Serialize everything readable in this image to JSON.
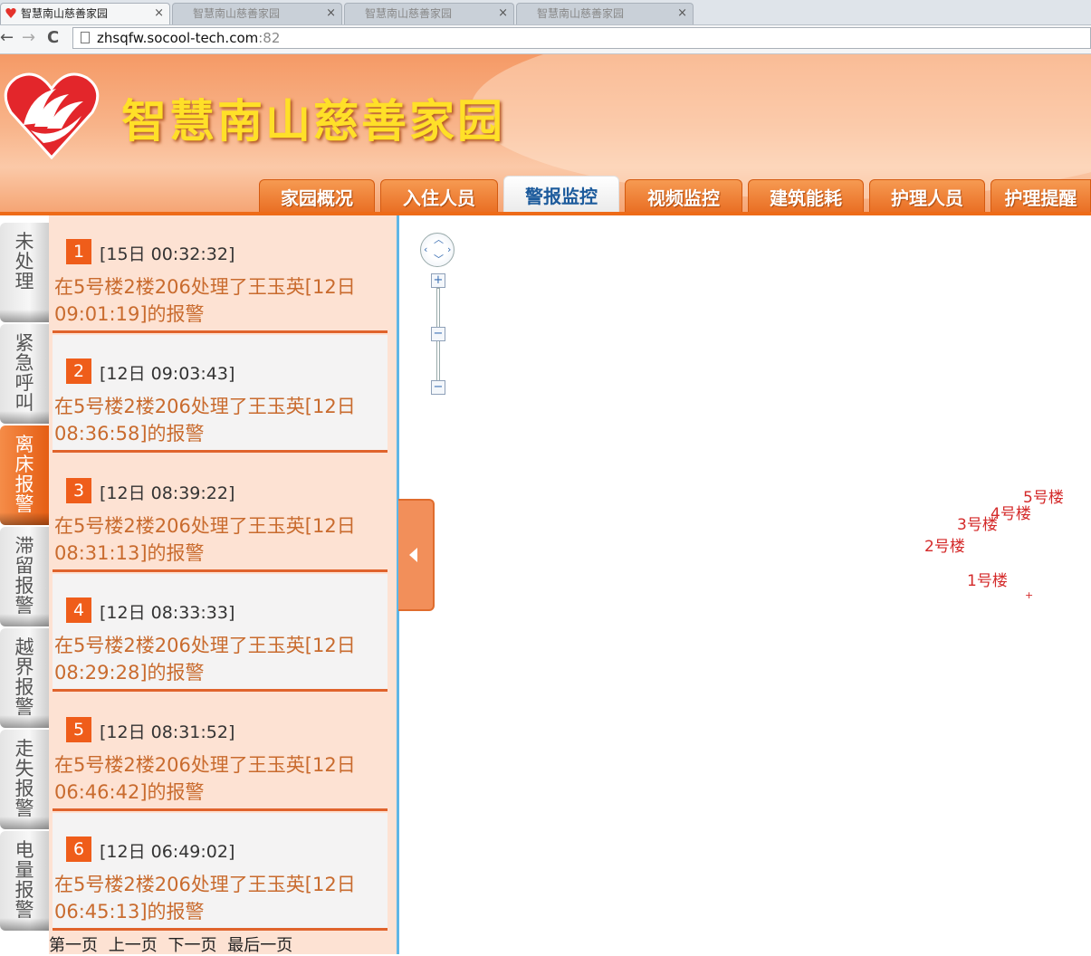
{
  "browser": {
    "tabs": [
      {
        "title": "智慧南山慈善家园",
        "close": "×"
      },
      {
        "title": "智慧南山慈善家园",
        "close": "×"
      },
      {
        "title": "智慧南山慈善家园",
        "close": "×"
      },
      {
        "title": "智慧南山慈善家园",
        "close": "×"
      }
    ],
    "url_host": "zhsqfw.socool-tech.com",
    "url_port": ":82",
    "back": "←",
    "forward": "→",
    "reload": "C"
  },
  "site": {
    "title": "智慧南山慈善家园",
    "nav": [
      "家园概况",
      "入住人员",
      "警报监控",
      "视频监控",
      "建筑能耗",
      "护理人员",
      "护理提醒"
    ],
    "active_nav": "警报监控"
  },
  "categories": [
    "未处理",
    "紧急呼叫",
    "离床报警",
    "滞留报警",
    "越界报警",
    "走失报警",
    "电量报警"
  ],
  "active_category": "离床报警",
  "alarms": [
    {
      "num": "1",
      "time": "[15日 00:32:32]",
      "desc": "在5号楼2楼206处理了王玉英[12日09:01:19]的报警"
    },
    {
      "num": "2",
      "time": "[12日 09:03:43]",
      "desc": "在5号楼2楼206处理了王玉英[12日08:36:58]的报警"
    },
    {
      "num": "3",
      "time": "[12日 08:39:22]",
      "desc": "在5号楼2楼206处理了王玉英[12日08:31:13]的报警"
    },
    {
      "num": "4",
      "time": "[12日 08:33:33]",
      "desc": "在5号楼2楼206处理了王玉英[12日08:29:28]的报警"
    },
    {
      "num": "5",
      "time": "[12日 08:31:52]",
      "desc": "在5号楼2楼206处理了王玉英[12日06:46:42]的报警"
    },
    {
      "num": "6",
      "time": "[12日 06:49:02]",
      "desc": "在5号楼2楼206处理了王玉英[12日06:45:13]的报警"
    }
  ],
  "pager": {
    "first": "第一页",
    "prev": "上一页",
    "next": "下一页",
    "last": "最后一页"
  },
  "map": {
    "zoom_in": "+",
    "zoom_out": "−",
    "buildings": [
      "5号楼",
      "4号楼",
      "3号楼",
      "2号楼",
      "1号楼"
    ],
    "marker": "+"
  },
  "colors": {
    "accent": "#ef5d1a",
    "title": "#ffe028",
    "building_label": "#d42a2a",
    "divider": "#5fb6e6"
  }
}
